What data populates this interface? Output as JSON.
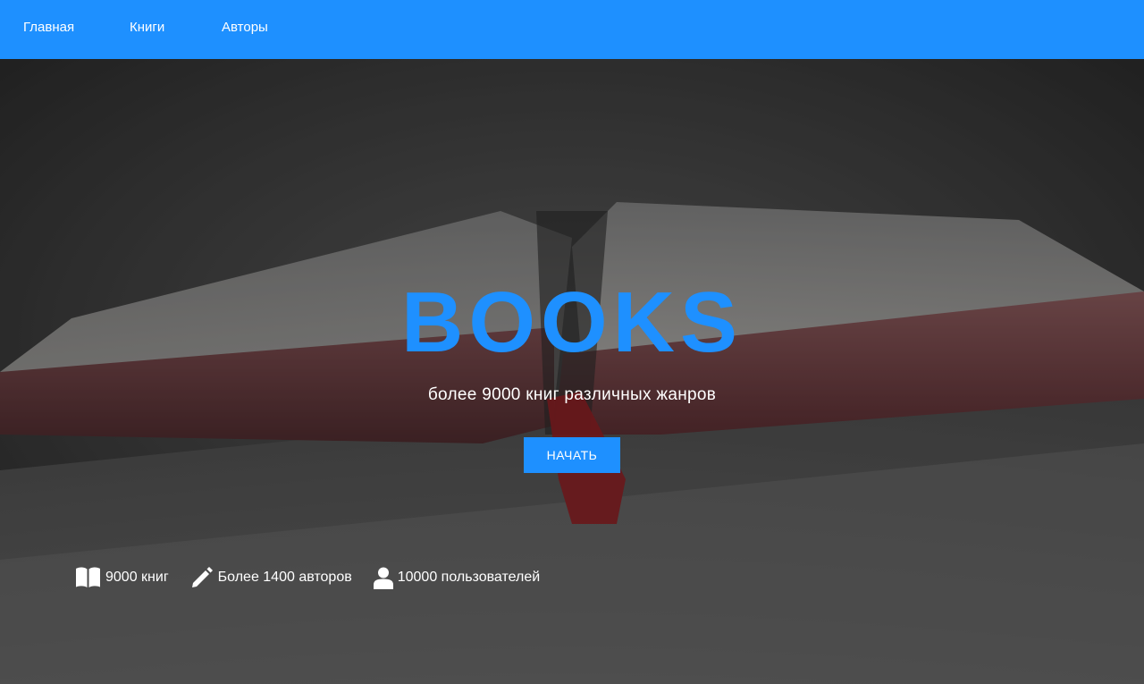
{
  "nav": {
    "items": [
      {
        "label": "Главная"
      },
      {
        "label": "Книги"
      },
      {
        "label": "Авторы"
      }
    ],
    "background": "#1e90ff"
  },
  "hero": {
    "title": "BOOKS",
    "subtitle": "более 9000 книг различных жанров",
    "button_label": "НАЧАТЬ",
    "accent": "#1e90ff",
    "background_image": "open-book-photo"
  },
  "stats": [
    {
      "icon": "open-book-icon",
      "text": "9000 книг"
    },
    {
      "icon": "pencil-icon",
      "text": "Более 1400 авторов"
    },
    {
      "icon": "user-icon",
      "text": "10000 пользователей"
    }
  ]
}
